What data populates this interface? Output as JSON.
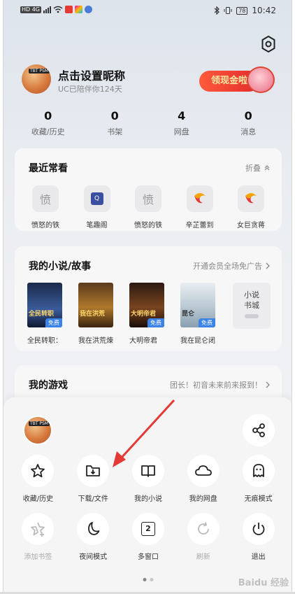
{
  "statusbar": {
    "network": "HD 4G",
    "time": "10:42",
    "battery": "78"
  },
  "profile": {
    "nickname": "点击设置昵称",
    "subtitle": "UC已陪伴你124天",
    "promo_label": "领现金啦",
    "avatar_tag": "TBT PSM"
  },
  "stats": [
    {
      "value": "0",
      "label": "收藏/历史"
    },
    {
      "value": "0",
      "label": "书架"
    },
    {
      "value": "4",
      "label": "网盘"
    },
    {
      "value": "0",
      "label": "消息"
    }
  ],
  "recent": {
    "title": "最近常看",
    "action": "折叠",
    "items": [
      {
        "icon_char": "愤",
        "label": "愤怒的铁"
      },
      {
        "icon_char": "Q",
        "label": "笔趣阁"
      },
      {
        "icon_char": "愤",
        "label": "愤怒的铁"
      },
      {
        "icon_char": "",
        "label": "辛芷蕾到"
      },
      {
        "icon_char": "",
        "label": "女巨贪蒋"
      }
    ]
  },
  "novels": {
    "title": "我的小说/故事",
    "action": "开通会员全场免广告",
    "books": [
      {
        "title": "全民转职：",
        "badge": "免费",
        "cover_text": "全民转职"
      },
      {
        "title": "我在洪荒煉",
        "badge": "免费",
        "cover_text": "我在洪荒"
      },
      {
        "title": "大明帝君",
        "badge": "免费",
        "cover_text": "大明帝君"
      },
      {
        "title": "我在昆仑闭",
        "badge": "免费",
        "cover_text": "昆仑"
      }
    ],
    "city_label_1": "小说",
    "city_label_2": "书城"
  },
  "games": {
    "title": "我的游戏",
    "action": "团长！初音未来前来报到！"
  },
  "menu": {
    "row1": [
      {
        "icon": "star-icon",
        "label": "收藏/历史",
        "enabled": true
      },
      {
        "icon": "download-folder-icon",
        "label": "下载/文件",
        "enabled": true
      },
      {
        "icon": "book-icon",
        "label": "我的小说",
        "enabled": true
      },
      {
        "icon": "cloud-icon",
        "label": "我的网盘",
        "enabled": true
      },
      {
        "icon": "ghost-icon",
        "label": "无痕模式",
        "enabled": true
      }
    ],
    "row2": [
      {
        "icon": "add-star-icon",
        "label": "添加书签",
        "enabled": false
      },
      {
        "icon": "moon-icon",
        "label": "夜间模式",
        "enabled": true
      },
      {
        "icon": "windows-icon",
        "label": "多窗口",
        "enabled": true,
        "count": "2"
      },
      {
        "icon": "refresh-icon",
        "label": "刷新",
        "enabled": false
      },
      {
        "icon": "power-icon",
        "label": "退出",
        "enabled": true
      }
    ]
  },
  "watermark": "Baidu 经验",
  "colors": {
    "accent": "#e22c2c",
    "badge_blue": "#3c83e7",
    "arrow": "#e53935"
  }
}
